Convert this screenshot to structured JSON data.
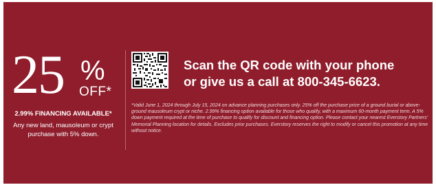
{
  "offer": {
    "number": "25",
    "percent_sign": "%",
    "off_text": "OFF*",
    "financing": "2.99% FINANCING AVAILABLE*",
    "description": "Any new land, mausoleum or crypt purchase with 5% down."
  },
  "cta": {
    "line1": "Scan the QR code with your phone",
    "line2": "or give us a call at 800-345-6623."
  },
  "qr": {
    "icon": "qr-code-icon"
  },
  "disclaimer": "*Valid June 1, 2024 through July 15, 2024 on advance planning purchases only. 25% off the purchase price of a ground burial or above-ground mausoleum crypt or niche. 2.99% financing option available for those who qualify, with a maximum 60-month payment term. A 5% down payment required at the time of purchase to qualify for discount and financing option. Please contact your nearest Everstory Partners' Memorial Planning location for details. Excludes prior purchases. Everstory reserves the right to modify or cancel this promotion at any time without notice.",
  "colors": {
    "background": "#8f1d2c",
    "text": "#ffffff"
  }
}
